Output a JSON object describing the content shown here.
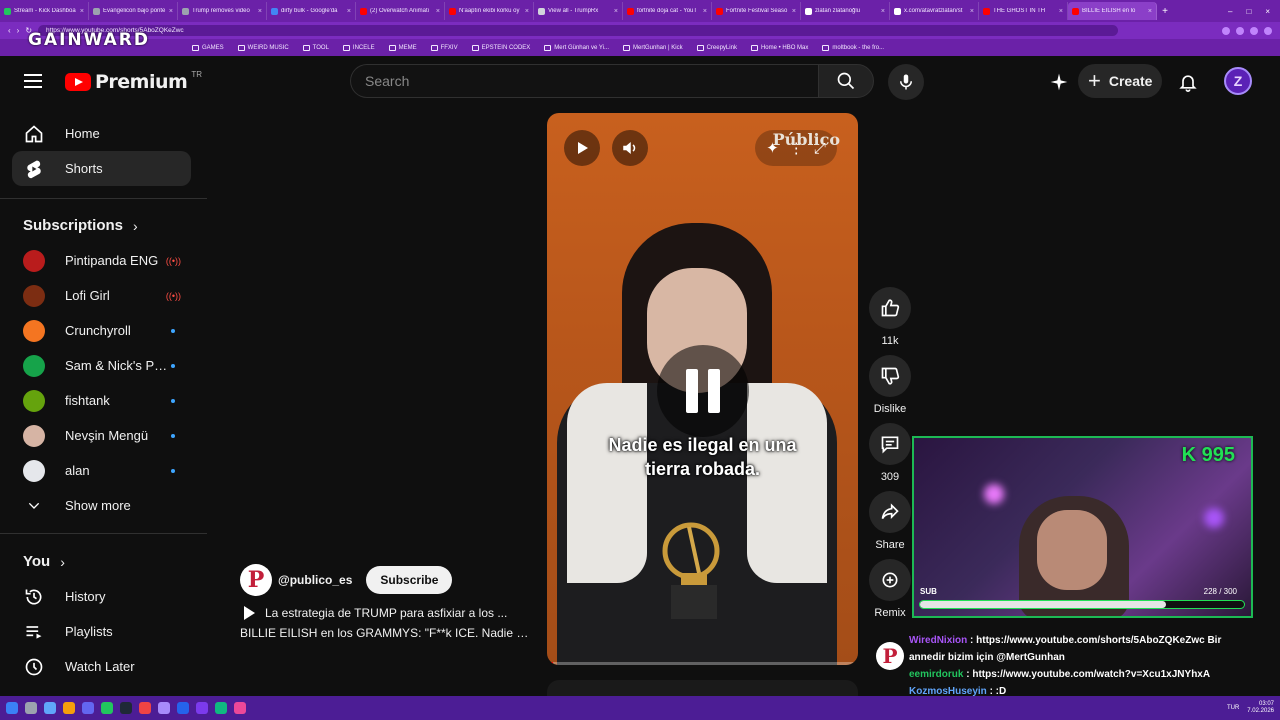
{
  "browser": {
    "tabs": [
      {
        "label": "Stream - Kick Dashboa",
        "color": "#22c55e"
      },
      {
        "label": "Evangelicon bajo ponte",
        "color": "#9ca3af"
      },
      {
        "label": "Trump removes video",
        "color": "#9ca3af"
      },
      {
        "label": "dirty bulk - Google'da",
        "color": "#4285f4"
      },
      {
        "label": "(2) Overwatch Animati",
        "color": "#ff0000"
      },
      {
        "label": "N'aaptın ekibi korku oy",
        "color": "#ff0000"
      },
      {
        "label": "View all - TrumpRx",
        "color": "#d1d5db"
      },
      {
        "label": "fortnite doja cat - YouT",
        "color": "#ff0000"
      },
      {
        "label": "Fortnite Festival Seaso",
        "color": "#ff0000"
      },
      {
        "label": "zlatan zlatanoğlu",
        "color": "#ffffff"
      },
      {
        "label": "x.com/atavratzlatan/st",
        "color": "#ffffff"
      },
      {
        "label": "THE GHOST IN TH",
        "color": "#ff0000"
      },
      {
        "label": "BILLIE EILISH en lo",
        "color": "#ff0000"
      }
    ],
    "url": "https://www.youtube.com/shorts/5AboZQKeZwc",
    "bookmarks": [
      "GAMES",
      "WEIRD MUSIC",
      "TOOL",
      "INCELE",
      "MEME",
      "FFXIV",
      "EPSTEIN CODEX",
      "Mert Günhan ve Yi...",
      "MertGunhan | Kick",
      "CreepyLink",
      "Home • HBO Max",
      "moltbook - the fro..."
    ],
    "overlay_logo": "GAINWARD"
  },
  "header": {
    "logo_text": "Premium",
    "logo_region": "TR",
    "search_placeholder": "Search",
    "create_label": "Create",
    "avatar_letter": "Z"
  },
  "sidebar": {
    "main": [
      {
        "label": "Home",
        "icon": "home-icon"
      },
      {
        "label": "Shorts",
        "icon": "shorts-icon",
        "active": true
      }
    ],
    "subscriptions_title": "Subscriptions",
    "subscriptions": [
      {
        "label": "Pintipanda ENG",
        "status": "live",
        "color": "#b91c1c"
      },
      {
        "label": "Lofi Girl",
        "status": "live",
        "color": "#7c2d12"
      },
      {
        "label": "Crunchyroll",
        "status": "new",
        "color": "#f47521"
      },
      {
        "label": "Sam & Nick's Per...",
        "status": "new",
        "color": "#16a34a"
      },
      {
        "label": "fishtank",
        "status": "new",
        "color": "#65a30d"
      },
      {
        "label": "Nevşin Mengü",
        "status": "new",
        "color": "#d6b4a4"
      },
      {
        "label": "alan",
        "status": "new",
        "color": "#e5e7eb"
      }
    ],
    "show_more": "Show more",
    "you_title": "You",
    "you_items": [
      {
        "label": "History",
        "icon": "history-icon"
      },
      {
        "label": "Playlists",
        "icon": "playlists-icon"
      },
      {
        "label": "Watch Later",
        "icon": "watch-later-icon"
      }
    ]
  },
  "short": {
    "channel_handle": "@publico_es",
    "channel_initial": "P",
    "subscribe_label": "Subscribe",
    "playlist_title": "La estrategia de TRUMP para asfixiar a los ...",
    "title": "BILLIE EILISH en los GRAMMYS: \"F**k ICE. Nadie es ...",
    "brand_watermark": "Público",
    "caption_line1": "Nadie es ilegal en una",
    "caption_line2": "tierra robada.",
    "progress_fraction": 0.02
  },
  "actions": {
    "like_count": "11k",
    "dislike_label": "Dislike",
    "comment_count": "309",
    "share_label": "Share",
    "remix_label": "Remix"
  },
  "stream_overlay": {
    "kick_count": "K 995",
    "sub_label": "SUB",
    "sub_progress": "228 / 300",
    "sub_fraction": 0.76
  },
  "chat": [
    {
      "user": "WiredNixion",
      "message": ": https://www.youtube.com/shorts/5AboZQKeZwc Bir annedir bizim için @MertGunhan"
    },
    {
      "user": "eemirdoruk",
      "message": ": https://www.youtube.com/watch?v=Xcu1xJNYhxA"
    },
    {
      "user": "KozmosHuseyin",
      "message": ": :D"
    }
  ],
  "taskbar": {
    "lang": "TUR",
    "time": "03:07",
    "date": "7.02.2026"
  }
}
